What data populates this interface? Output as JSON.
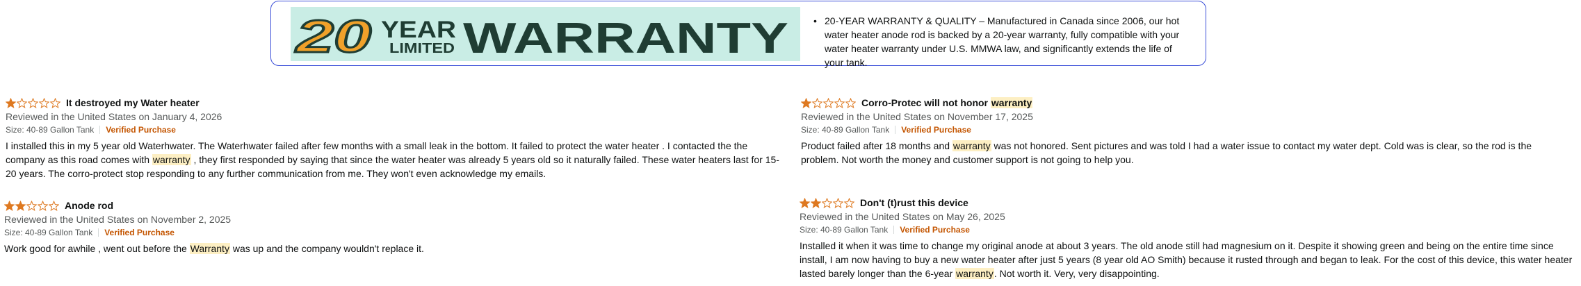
{
  "banner": {
    "image": {
      "number": "20",
      "year": "YEAR",
      "limited": "LIMITED",
      "warranty": "WARRANTY"
    },
    "bullet": "•",
    "text": "20-YEAR WARRANTY & QUALITY – Manufactured in Canada since 2006, our hot water heater anode rod is backed by a 20-year warranty, fully compatible with your water heater warranty under U.S. MMWA law, and significantly extends the life of your tank."
  },
  "colors": {
    "star": "#de7921",
    "verified": "#c45500",
    "highlight": "#fdefc3",
    "banner_border": "#3b4fd8",
    "image_bg": "#c9ede5"
  },
  "reviews": [
    {
      "rating": 1,
      "title": "It destroyed my Water heater",
      "title_parts": [
        {
          "t": "It destroyed my Water heater",
          "h": false
        }
      ],
      "date": "Reviewed in the United States on January 4, 2026",
      "size": "Size: 40-89 Gallon Tank",
      "verified": "Verified Purchase",
      "body_parts": [
        {
          "t": "I installed this in my 5 year old Waterhwater. The Waterhwater failed after few months with a small leak in the bottom. It failed to protect the water heater . I contacted the the company as this road comes with ",
          "h": false
        },
        {
          "t": "warranty",
          "h": true
        },
        {
          "t": " , they first responded by saying that since the water heater was already 5 years old so it naturally failed. These water heaters last for 15-20 years. The corro-protect stop responding to any further communication from me. They won't even acknowledge my emails.",
          "h": false
        }
      ]
    },
    {
      "rating": 2,
      "title": "Anode rod",
      "title_parts": [
        {
          "t": "Anode rod",
          "h": false
        }
      ],
      "date": "Reviewed in the United States on November 2, 2025",
      "size": "Size: 40-89 Gallon Tank",
      "verified": "Verified Purchase",
      "body_parts": [
        {
          "t": "Work good for awhile , went out before the ",
          "h": false
        },
        {
          "t": "Warranty",
          "h": true
        },
        {
          "t": " was up and the company wouldn't replace it.",
          "h": false
        }
      ]
    },
    {
      "rating": 1,
      "title": "Corro-Protec will not honor warranty",
      "title_parts": [
        {
          "t": "Corro-Protec will not honor ",
          "h": false
        },
        {
          "t": "warranty",
          "h": true
        }
      ],
      "date": "Reviewed in the United States on November 17, 2025",
      "size": "Size: 40-89 Gallon Tank",
      "verified": "Verified Purchase",
      "body_parts": [
        {
          "t": "Product failed after 18 months and ",
          "h": false
        },
        {
          "t": "warranty",
          "h": true
        },
        {
          "t": " was not honored. Sent pictures and was told I had a water issue to contact my water dept. Cold was is clear, so the rod is the problem. Not worth the money and customer support is not going to help you.",
          "h": false
        }
      ]
    },
    {
      "rating": 2,
      "title": "Don't (t)rust this device",
      "title_parts": [
        {
          "t": "Don't (t)rust this device",
          "h": false
        }
      ],
      "date": "Reviewed in the United States on May 26, 2025",
      "size": "Size: 40-89 Gallon Tank",
      "verified": "Verified Purchase",
      "body_parts": [
        {
          "t": "Installed it when it was time to change my original anode at about 3 years. The old anode still had magnesium on it. Despite it showing green and being on the entire time since install, I am now having to buy a new water heater after just 5 years (8 year old AO Smith) because it rusted through and began to leak. For the cost of this device, this water heater lasted barely longer than the 6-year ",
          "h": false
        },
        {
          "t": "warranty",
          "h": true
        },
        {
          "t": ". Not worth it. Very, very disappointing.",
          "h": false
        }
      ]
    }
  ]
}
